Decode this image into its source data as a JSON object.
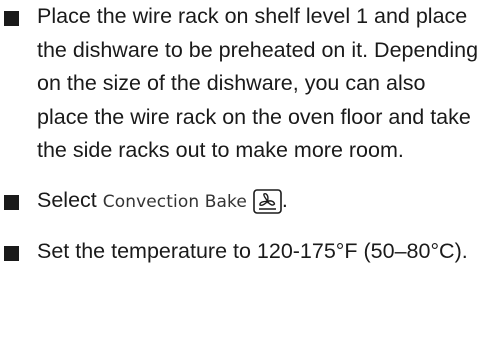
{
  "steps": [
    {
      "text": "Place the wire rack on shelf level 1 and place the dishware to be preheated on it. Depending on the size of the dishware, you can also place the wire rack on the oven floor and take the side racks out to make more room."
    },
    {
      "prefix": "Select ",
      "mode_name": "Convection Bake",
      "icon": "convection-fan-icon",
      "suffix": "."
    },
    {
      "text": "Set the temperature to 120-175°F (50–80°C)."
    }
  ]
}
